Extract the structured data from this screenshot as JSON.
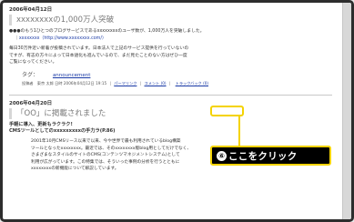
{
  "post1": {
    "date": "2006年04月12日",
    "title": "xxxxxxxxの1,000万人突破",
    "intro": "●●●のもう1ひとつのブログサービスであるxxxxxxxxのユーザ数が、1,000万人を突破しました。",
    "quote_link": "xxxxxxxx（http://www.xxxxxxxx.com/）",
    "body_lines": [
      "毎日30万件近い新着が投稿されています。日本法人で上記のサービス提供を行っていないの",
      "ですが、有志の方々によって日本語化も進んでいるので、まだ見たことのない方はぜひ一度",
      "ご覧になってください。"
    ],
    "tag_label": "タグ：",
    "tag_value": "announcement",
    "meta_prefix": "投稿者　東京 太郎 日時 2006年04月12日 19:15",
    "permalink": "パーマリンク",
    "comments": "コメント (0)",
    "trackback": "トラックバック (0)"
  },
  "post2": {
    "date": "2006年04月20日",
    "title": "「OO」に掲載されました",
    "subhead_1": "手軽に導入、更新もラクラク!",
    "subhead_2": "CMSツールとしてのxxxxxxxxxの手力ラ(P.86)",
    "body_lines": [
      "2001年10月CMSリース以来で以来、今や世界で最も利用されているblog構築",
      "ツールとなったxxxxxxxx。最近では、そのxxxxxxxx版blog用としてだけでなく、",
      "さまざまなスタイルのサイトのCMS(コンテンツマネジメントシステム)として",
      "利用が広がっています。この特集では、そういった事例の分析を行うとともに",
      "xxxxxxxxの新機能について解説しています。"
    ]
  },
  "callout": {
    "number": "⑥",
    "text": "ここをクリック"
  },
  "colors": {
    "highlight": "#f4d300",
    "link": "#1a3aa6",
    "callout_bg": "#000000"
  }
}
